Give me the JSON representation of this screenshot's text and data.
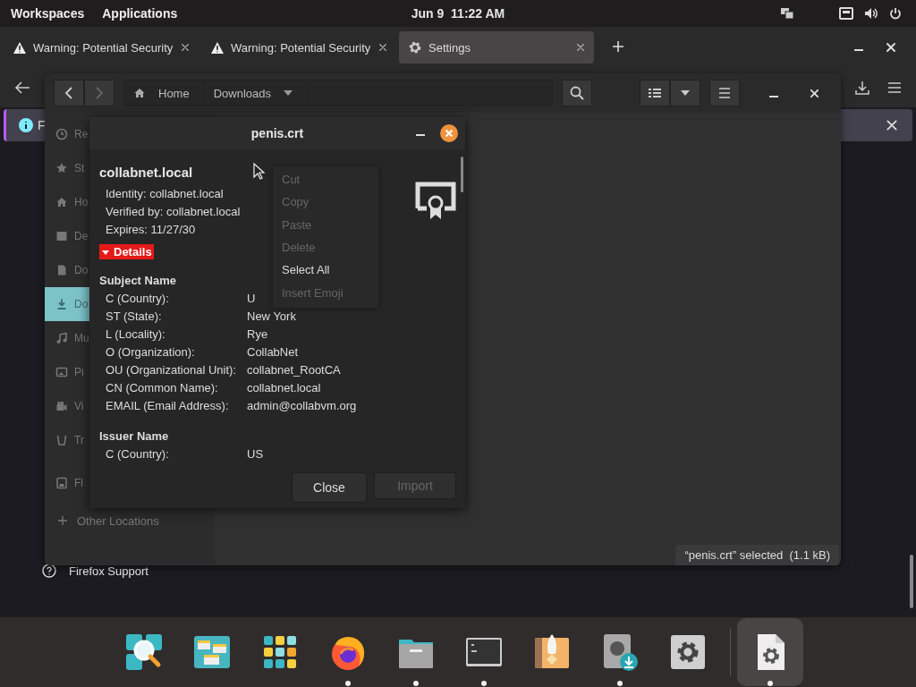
{
  "top_bar": {
    "menus": [
      "Workspaces",
      "Applications"
    ],
    "clock": "Jun 9  11:22 AM"
  },
  "browser": {
    "tabs": [
      {
        "label": "Warning: Potential Security",
        "kind": "warning",
        "selected": false
      },
      {
        "label": "Warning: Potential Security",
        "kind": "warning",
        "selected": false
      },
      {
        "label": "Settings",
        "kind": "settings",
        "selected": true
      }
    ],
    "info_bar": {
      "text": "F"
    },
    "support_link": "Firefox Support"
  },
  "file_chooser": {
    "path": [
      {
        "label": "Home",
        "kind": "home"
      },
      {
        "label": "Downloads",
        "kind": "folder"
      }
    ],
    "sidebar": {
      "items": [
        {
          "label": "Re",
          "selected": false
        },
        {
          "label": "St",
          "selected": false
        },
        {
          "label": "Ho",
          "selected": false
        },
        {
          "label": "De",
          "selected": false
        },
        {
          "label": "Do",
          "selected": false
        },
        {
          "label": "Do",
          "selected": true
        },
        {
          "label": "Mu",
          "selected": false
        },
        {
          "label": "Pi",
          "selected": false
        },
        {
          "label": "Vi",
          "selected": false
        },
        {
          "label": "Tr",
          "selected": false
        },
        {
          "label": "Fl",
          "selected": false
        }
      ],
      "other_locations": "Other Locations"
    },
    "status": "“penis.crt” selected  (1.1 kB)"
  },
  "dialog": {
    "title": "penis.crt",
    "name": "collabnet.local",
    "summary": [
      "Identity: collabnet.local",
      "Verified by: collabnet.local",
      "Expires: 11/27/30"
    ],
    "details": {
      "label": "Details",
      "expanded": true,
      "highlighted": true
    },
    "sections": [
      {
        "title": "Subject Name",
        "rows": [
          {
            "field": "C (Country):",
            "value": "U"
          },
          {
            "field": "ST (State):",
            "value": "New York"
          },
          {
            "field": "L (Locality):",
            "value": "Rye"
          },
          {
            "field": "O (Organization):",
            "value": "CollabNet"
          },
          {
            "field": "OU (Organizational Unit):",
            "value": "collabnet_RootCA"
          },
          {
            "field": "CN (Common Name):",
            "value": "collabnet.local"
          },
          {
            "field": "EMAIL (Email Address):",
            "value": "admin@collabvm.org"
          }
        ]
      },
      {
        "title": "Issuer Name",
        "rows": [
          {
            "field": "C (Country):",
            "value": "US"
          }
        ]
      }
    ],
    "buttons": [
      {
        "label": "Close",
        "disabled": false
      },
      {
        "label": "Import",
        "disabled": true
      }
    ]
  },
  "context_menu": {
    "items": [
      {
        "label": "Cut",
        "disabled": true
      },
      {
        "label": "Copy",
        "disabled": true
      },
      {
        "label": "Paste",
        "disabled": true
      },
      {
        "label": "Delete",
        "disabled": true
      },
      {
        "label": "Select All",
        "disabled": false
      },
      {
        "label": "Insert Emoji",
        "disabled": true
      }
    ]
  },
  "dock": [
    {
      "running": false,
      "selected": false
    },
    {
      "running": false,
      "selected": false
    },
    {
      "running": false,
      "selected": false
    },
    {
      "running": true,
      "selected": false
    },
    {
      "running": true,
      "selected": false
    },
    {
      "running": true,
      "selected": false
    },
    {
      "running": false,
      "selected": false
    },
    {
      "running": true,
      "selected": false
    },
    {
      "running": false,
      "selected": false
    },
    {
      "running": true,
      "selected": true
    }
  ]
}
